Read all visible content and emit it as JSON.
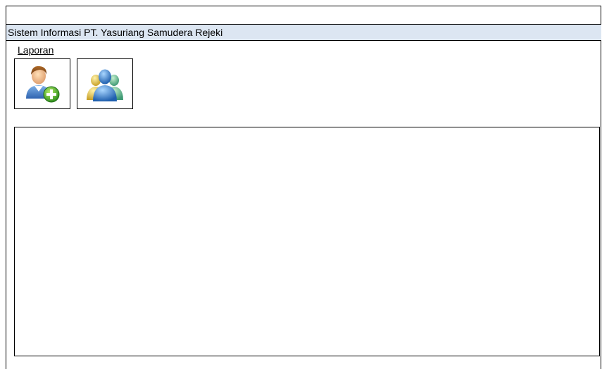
{
  "window": {
    "title": "Sistem Informasi PT. Yasuriang Samudera Rejeki"
  },
  "menu": {
    "report_label": "Laporan"
  },
  "toolbar": {
    "buttons": [
      {
        "icon": "add-user-icon"
      },
      {
        "icon": "user-group-icon"
      }
    ]
  },
  "colors": {
    "title_bar_bg": "#dce6f2",
    "border": "#000000"
  }
}
